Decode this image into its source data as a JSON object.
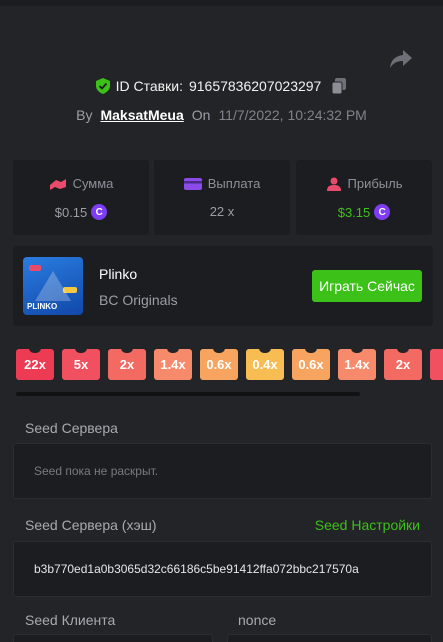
{
  "header": {
    "bet_id_label": "ID Ставки:",
    "bet_id": "91657836207023297",
    "by_label": "By",
    "username": "MaksatMeua",
    "on_label": "On",
    "datetime": "11/7/2022, 10:24:32 PM"
  },
  "stats": {
    "amount": {
      "label": "Сумма",
      "value": "$0.15",
      "icon": "money-bag-icon",
      "icon_color": "#e94b6b"
    },
    "payout": {
      "label": "Выплата",
      "value": "22 x",
      "icon": "card-icon",
      "icon_color": "#8a4be8"
    },
    "profit": {
      "label": "Прибыль",
      "value": "$3.15",
      "value_color": "#3bc117",
      "icon": "profit-user-icon",
      "icon_color": "#e94b6b"
    }
  },
  "game": {
    "name": "Plinko",
    "provider": "BC Originals",
    "play_label": "Играть Сейчас",
    "thumb_brand": "PLINKO"
  },
  "multipliers": [
    {
      "label": "22x",
      "color": "#ee3b54"
    },
    {
      "label": "5x",
      "color": "#f05060"
    },
    {
      "label": "2x",
      "color": "#f36a63"
    },
    {
      "label": "1.4x",
      "color": "#f68a6a"
    },
    {
      "label": "0.6x",
      "color": "#f7a460"
    },
    {
      "label": "0.4x",
      "color": "#f7bd52"
    },
    {
      "label": "0.6x",
      "color": "#f7a460"
    },
    {
      "label": "1.4x",
      "color": "#f68a6a"
    },
    {
      "label": "2x",
      "color": "#f36a63"
    },
    {
      "label": "",
      "color": "#f05060"
    }
  ],
  "seeds": {
    "server_seed_label": "Seed Сервера",
    "server_seed_value": "Seed пока не раскрыт.",
    "server_hash_label": "Seed Сервера (хэш)",
    "seed_settings_label": "Seed Настройки",
    "server_hash_value": "b3b770ed1a0b3065d32c66186c5be91412ffa072bbc217570a",
    "client_seed_label": "Seed Клиента",
    "nonce_label": "nonce"
  },
  "colors": {
    "accent_green": "#3bc117",
    "background": "#232427",
    "card": "#1c1d21"
  }
}
